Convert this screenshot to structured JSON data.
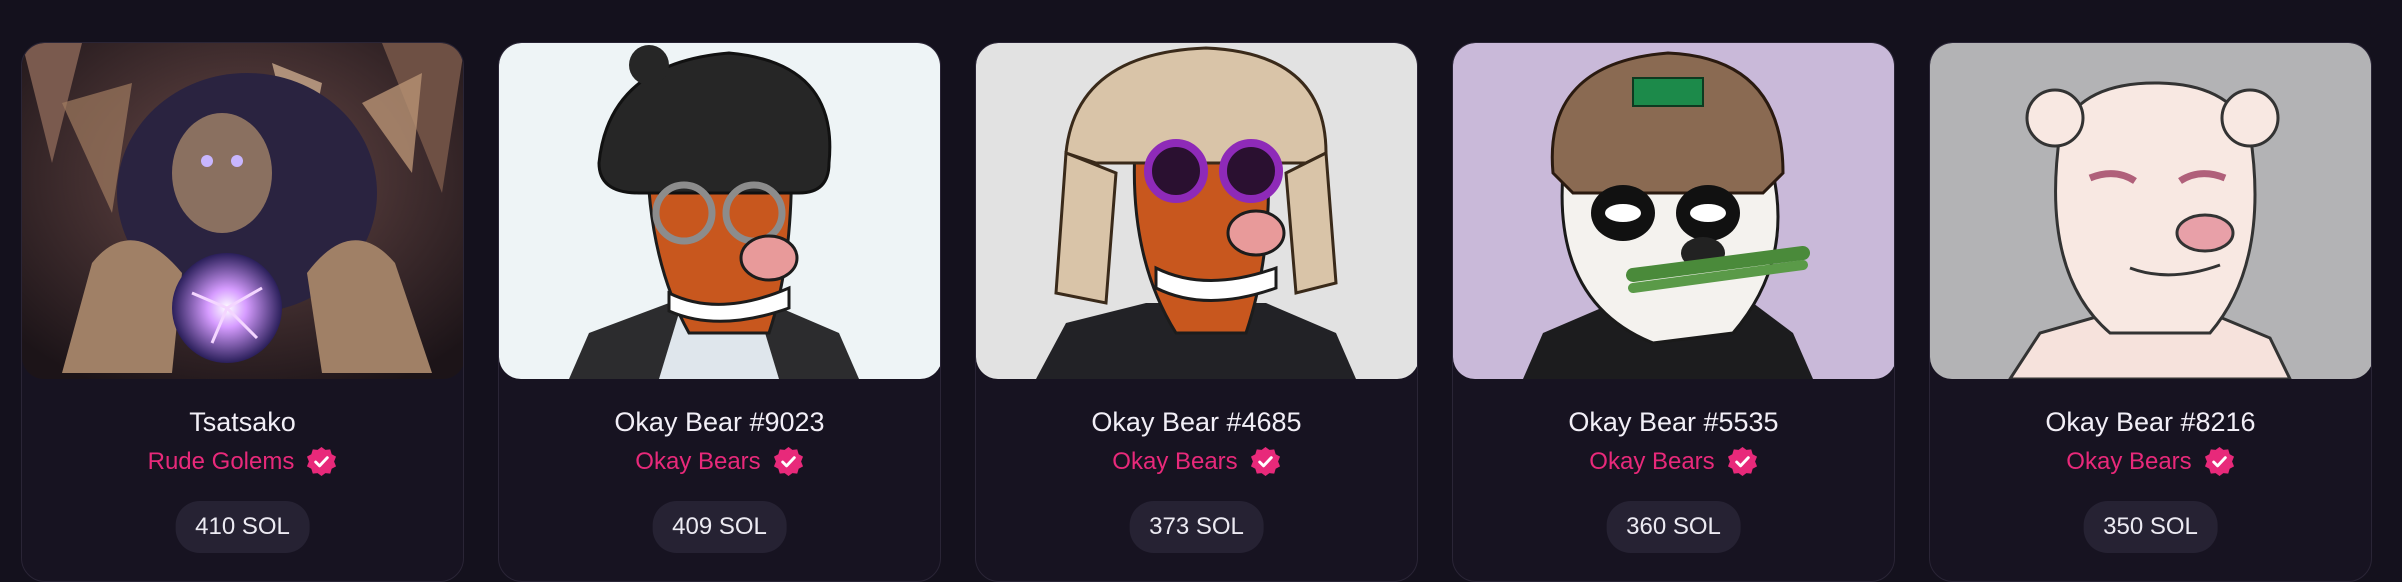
{
  "items": [
    {
      "name": "Tsatsako",
      "collection": "Rude Golems",
      "price": "410 SOL",
      "verified": true,
      "bg": "#3a2a2c"
    },
    {
      "name": "Okay Bear #9023",
      "collection": "Okay Bears",
      "price": "409 SOL",
      "verified": true,
      "bg": "#eef4f6"
    },
    {
      "name": "Okay Bear #4685",
      "collection": "Okay Bears",
      "price": "373 SOL",
      "verified": true,
      "bg": "#e2e2e2"
    },
    {
      "name": "Okay Bear #5535",
      "collection": "Okay Bears",
      "price": "360 SOL",
      "verified": true,
      "bg": "#c9b9d9"
    },
    {
      "name": "Okay Bear #8216",
      "collection": "Okay Bears",
      "price": "350 SOL",
      "verified": true,
      "bg": "#b3b3b5"
    }
  ],
  "colors": {
    "accent": "#e8297a",
    "page_bg": "#14111d",
    "card_bg": "#171321",
    "price_bg": "#262233"
  },
  "icons": {
    "verified": "verified-check-icon"
  }
}
